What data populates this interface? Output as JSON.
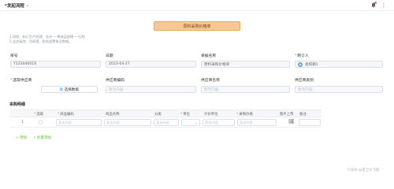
{
  "header": {
    "flow_title": "*发起流程"
  },
  "form": {
    "banner_title": "原料采购价格单",
    "tips": [
      "1.流程：制订生产经理、会计----审核品经理----归档",
      "2.业务板块、功经理、财务部费卷全数据。"
    ],
    "fields": {
      "doc_no": {
        "label": "单号",
        "value": "Y123040016"
      },
      "date": {
        "label": "日期",
        "value": "2023-04-27"
      },
      "doc_name": {
        "label": "单据名称",
        "value": "原料采购价格单"
      },
      "creator": {
        "label": "制订人",
        "value": "袁校颖1"
      },
      "supplier_select": {
        "label": "选取供应商",
        "button": "选择数据"
      },
      "supplier_code": {
        "label": "供应商编码",
        "placeholder": "暂无内容"
      },
      "supplier_name": {
        "label": "供应商名称",
        "placeholder": "暂无内容"
      },
      "supplier_type": {
        "label": "供应商类别",
        "placeholder": "暂无内容"
      }
    }
  },
  "details": {
    "title": "采购明细",
    "columns": [
      "选取",
      "商品编码",
      "商品名称",
      "分类",
      "单位",
      "计价单位",
      "采购价格",
      "图片上传",
      "备注"
    ],
    "rows": [
      {
        "index": "1",
        "code_placeholder": "暂无内容",
        "name_placeholder": "暂无内容",
        "category_placeholder": "暂无内容",
        "pricing_unit_placeholder": "暂无内容",
        "price_placeholder": "暂无内容"
      }
    ],
    "actions": {
      "add": "添加",
      "batch_add": "批量添加"
    }
  },
  "watermark": "CSDN @是卫大飞呢",
  "colors": {
    "banner": "#f7c894",
    "required": "#f56c6c",
    "action": "#67c23a",
    "link_icon": "#409eff"
  }
}
